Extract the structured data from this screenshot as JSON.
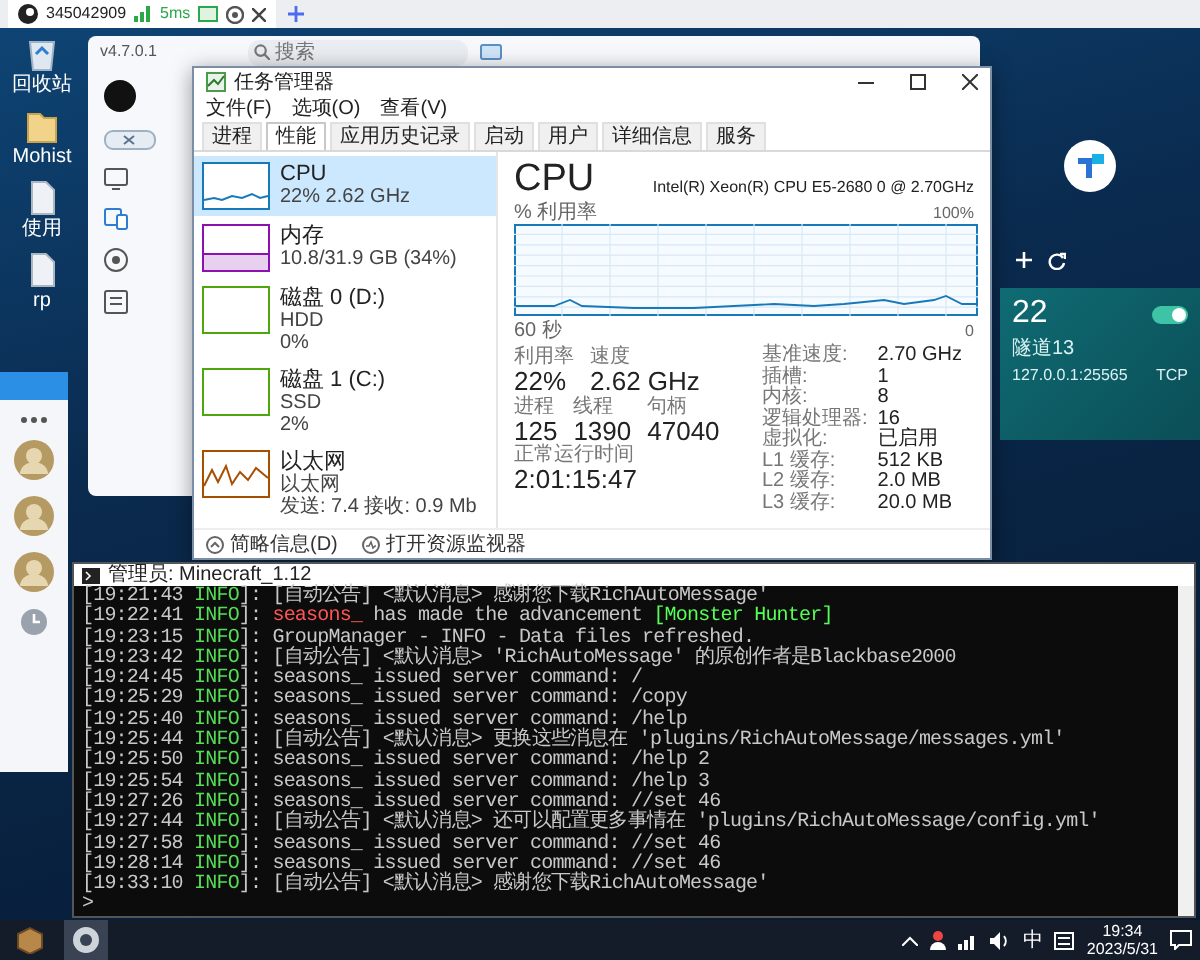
{
  "remote_tab": {
    "title": "345042909",
    "latency": "5ms"
  },
  "desktop_icons": [
    {
      "label": "回收站",
      "kind": "recycle"
    },
    {
      "label": "Mohist",
      "kind": "folder"
    },
    {
      "label": "使用",
      "kind": "file"
    },
    {
      "label": "rp",
      "kind": "file"
    }
  ],
  "client_app": {
    "version": "v4.7.0.1",
    "search": {
      "placeholder": "搜索"
    }
  },
  "task_manager": {
    "title": "任务管理器",
    "menu": [
      "文件(F)",
      "选项(O)",
      "查看(V)"
    ],
    "tabs": [
      {
        "label": "进程",
        "selected": false
      },
      {
        "label": "性能",
        "selected": true
      },
      {
        "label": "应用历史记录",
        "selected": false
      },
      {
        "label": "启动",
        "selected": false
      },
      {
        "label": "用户",
        "selected": false
      },
      {
        "label": "详细信息",
        "selected": false
      },
      {
        "label": "服务",
        "selected": false
      }
    ],
    "resources": [
      {
        "name": "CPU",
        "lines": [
          "22% 2.62 GHz"
        ],
        "kind": "cpu",
        "selected": true
      },
      {
        "name": "内存",
        "lines": [
          "10.8/31.9 GB (34%)"
        ],
        "kind": "memory",
        "selected": false
      },
      {
        "name": "磁盘 0 (D:)",
        "lines": [
          "HDD",
          "0%"
        ],
        "kind": "disk",
        "selected": false
      },
      {
        "name": "磁盘 1 (C:)",
        "lines": [
          "SSD",
          "2%"
        ],
        "kind": "disk",
        "selected": false
      },
      {
        "name": "以太网",
        "lines": [
          "以太网",
          "发送: 7.4 接收: 0.9 Mb"
        ],
        "kind": "network",
        "selected": false
      }
    ],
    "cpu": {
      "title": "CPU",
      "model": "Intel(R) Xeon(R) CPU E5-2680 0 @ 2.70GHz",
      "graph_label": "% 利用率",
      "graph_max": "100%",
      "graph_span": "60 秒",
      "graph_min": "0",
      "stat_rows": [
        [
          {
            "label": "利用率",
            "value": "22%"
          },
          {
            "label": "速度",
            "value": "2.62 GHz"
          }
        ],
        [
          {
            "label": "进程",
            "value": "125"
          },
          {
            "label": "线程",
            "value": "1390"
          },
          {
            "label": "句柄",
            "value": "47040"
          }
        ],
        [
          {
            "label": "正常运行时间",
            "value": "2:01:15:47"
          }
        ]
      ],
      "details": [
        {
          "label": "基准速度:",
          "value": "2.70 GHz"
        },
        {
          "label": "插槽:",
          "value": "1"
        },
        {
          "label": "内核:",
          "value": "8"
        },
        {
          "label": "逻辑处理器:",
          "value": "16"
        },
        {
          "label": "虚拟化:",
          "value": "已启用"
        },
        {
          "label": "L1 缓存:",
          "value": "512 KB"
        },
        {
          "label": "L2 缓存:",
          "value": "2.0 MB"
        },
        {
          "label": "L3 缓存:",
          "value": "20.0 MB"
        }
      ]
    },
    "footer": [
      {
        "label": "简略信息(D)",
        "kind": "collapse"
      },
      {
        "label": "打开资源监视器",
        "kind": "monitor"
      }
    ]
  },
  "tunnel_panel": {
    "port": "22",
    "name": "隧道13",
    "address": "127.0.0.1:25565",
    "protocol": "TCP",
    "on": true
  },
  "console": {
    "title": "管理员: Minecraft_1.12",
    "lines": [
      {
        "segments": [
          {
            "text": "[19:21:43 ",
            "kind": "plain"
          },
          {
            "text": "INFO",
            "kind": "level"
          },
          {
            "text": "]: [自动公告] <默认消息> 感谢您下载RichAutoMessage'",
            "kind": "plain"
          }
        ]
      },
      {
        "segments": [
          {
            "text": "[19:22:41 ",
            "kind": "plain"
          },
          {
            "text": "INFO",
            "kind": "level"
          },
          {
            "text": "]: ",
            "kind": "plain"
          },
          {
            "text": "seasons_",
            "kind": "player"
          },
          {
            "text": " has made the advancement ",
            "kind": "plain"
          },
          {
            "text": "[Monster Hunter]",
            "kind": "advancement"
          }
        ]
      },
      {
        "segments": [
          {
            "text": "[19:23:15 ",
            "kind": "plain"
          },
          {
            "text": "INFO",
            "kind": "level"
          },
          {
            "text": "]: GroupManager - INFO - Data files refreshed.",
            "kind": "plain"
          }
        ]
      },
      {
        "segments": [
          {
            "text": "[19:23:42 ",
            "kind": "plain"
          },
          {
            "text": "INFO",
            "kind": "level"
          },
          {
            "text": "]: [自动公告] <默认消息> 'RichAutoMessage' 的原创作者是Blackbase2000",
            "kind": "plain"
          }
        ]
      },
      {
        "segments": [
          {
            "text": "[19:24:45 ",
            "kind": "plain"
          },
          {
            "text": "INFO",
            "kind": "level"
          },
          {
            "text": "]: seasons_ issued server command: /",
            "kind": "plain"
          }
        ]
      },
      {
        "segments": [
          {
            "text": "[19:25:29 ",
            "kind": "plain"
          },
          {
            "text": "INFO",
            "kind": "level"
          },
          {
            "text": "]: seasons_ issued server command: /copy",
            "kind": "plain"
          }
        ]
      },
      {
        "segments": [
          {
            "text": "[19:25:40 ",
            "kind": "plain"
          },
          {
            "text": "INFO",
            "kind": "level"
          },
          {
            "text": "]: seasons_ issued server command: /help",
            "kind": "plain"
          }
        ]
      },
      {
        "segments": [
          {
            "text": "[19:25:44 ",
            "kind": "plain"
          },
          {
            "text": "INFO",
            "kind": "level"
          },
          {
            "text": "]: [自动公告] <默认消息> 更换这些消息在 'plugins/RichAutoMessage/messages.yml'",
            "kind": "plain"
          }
        ]
      },
      {
        "segments": [
          {
            "text": "[19:25:50 ",
            "kind": "plain"
          },
          {
            "text": "INFO",
            "kind": "level"
          },
          {
            "text": "]: seasons_ issued server command: /help 2",
            "kind": "plain"
          }
        ]
      },
      {
        "segments": [
          {
            "text": "[19:25:54 ",
            "kind": "plain"
          },
          {
            "text": "INFO",
            "kind": "level"
          },
          {
            "text": "]: seasons_ issued server command: /help 3",
            "kind": "plain"
          }
        ]
      },
      {
        "segments": [
          {
            "text": "[19:27:26 ",
            "kind": "plain"
          },
          {
            "text": "INFO",
            "kind": "level"
          },
          {
            "text": "]: seasons_ issued server command: //set 46",
            "kind": "plain"
          }
        ]
      },
      {
        "segments": [
          {
            "text": "[19:27:44 ",
            "kind": "plain"
          },
          {
            "text": "INFO",
            "kind": "level"
          },
          {
            "text": "]: [自动公告] <默认消息> 还可以配置更多事情在 'plugins/RichAutoMessage/config.yml'",
            "kind": "plain"
          }
        ]
      },
      {
        "segments": [
          {
            "text": "[19:27:58 ",
            "kind": "plain"
          },
          {
            "text": "INFO",
            "kind": "level"
          },
          {
            "text": "]: seasons_ issued server command: //set 46",
            "kind": "plain"
          }
        ]
      },
      {
        "segments": [
          {
            "text": "[19:28:14 ",
            "kind": "plain"
          },
          {
            "text": "INFO",
            "kind": "level"
          },
          {
            "text": "]: seasons_ issued server command: //set 46",
            "kind": "plain"
          }
        ]
      },
      {
        "segments": [
          {
            "text": "[19:33:10 ",
            "kind": "plain"
          },
          {
            "text": "INFO",
            "kind": "level"
          },
          {
            "text": "]: [自动公告] <默认消息> 感谢您下载RichAutoMessage'",
            "kind": "plain"
          }
        ]
      },
      {
        "segments": [
          {
            "text": ">",
            "kind": "plain"
          }
        ]
      }
    ]
  },
  "taskbar": {
    "ime": "中",
    "time": "19:34",
    "date": "2023/5/31"
  }
}
